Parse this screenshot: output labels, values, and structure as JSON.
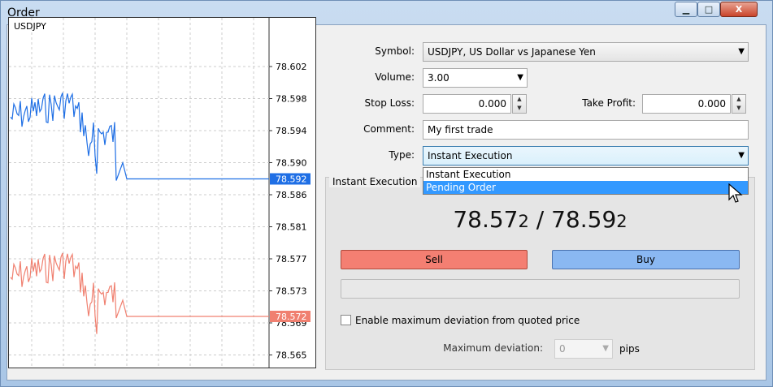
{
  "window": {
    "title": "Order",
    "min_label": "▁",
    "max_label": "□",
    "close_label": "X"
  },
  "chart": {
    "symbol": "USDJPY",
    "price_labels": [
      "78.602",
      "78.598",
      "78.594",
      "78.590",
      "78.586",
      "78.581",
      "78.577",
      "78.573",
      "78.569",
      "78.565"
    ],
    "ask_marker": "78.592",
    "bid_marker": "78.572",
    "ask_color": "#1f6fe5",
    "bid_color": "#f08070"
  },
  "form": {
    "symbol_label": "Symbol:",
    "symbol_value": "USDJPY, US Dollar vs Japanese Yen",
    "volume_label": "Volume:",
    "volume_value": "3.00",
    "stoploss_label": "Stop Loss:",
    "stoploss_value": "0.000",
    "takeprofit_label": "Take Profit:",
    "takeprofit_value": "0.000",
    "comment_label": "Comment:",
    "comment_value": "My first trade",
    "type_label": "Type:",
    "type_value": "Instant Execution",
    "type_options": [
      "Instant Execution",
      "Pending Order"
    ]
  },
  "execution": {
    "group_label": "Instant Execution",
    "bid_main": "78.57",
    "bid_pip": "2",
    "separator": " / ",
    "ask_main": "78.59",
    "ask_pip": "2",
    "sell_label": "Sell",
    "buy_label": "Buy",
    "sell_color": "#f47f72",
    "buy_color": "#8ab8f2",
    "deviation_checkbox_label": "Enable maximum deviation from quoted price",
    "max_deviation_label": "Maximum deviation:",
    "max_deviation_value": "0",
    "pips_label": "pips"
  }
}
